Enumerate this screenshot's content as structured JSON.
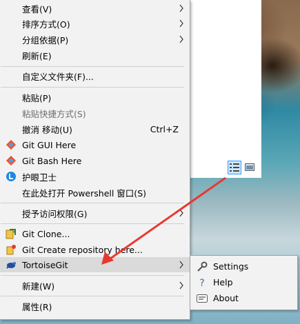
{
  "context_menu": {
    "items": [
      {
        "label": "查看(V)"
      },
      {
        "label": "排序方式(O)"
      },
      {
        "label": "分组依据(P)"
      },
      {
        "label": "刷新(E)"
      },
      {
        "label": "自定义文件夹(F)..."
      },
      {
        "label": "粘贴(P)"
      },
      {
        "label": "粘贴快捷方式(S)"
      },
      {
        "label": "撤消 移动(U)",
        "shortcut": "Ctrl+Z"
      },
      {
        "label": "Git GUI Here"
      },
      {
        "label": "Git Bash Here"
      },
      {
        "label": "护眼卫士"
      },
      {
        "label": "在此处打开 Powershell 窗口(S)"
      },
      {
        "label": "授予访问权限(G)"
      },
      {
        "label": "Git Clone..."
      },
      {
        "label": "Git Create repository here..."
      },
      {
        "label": "TortoiseGit"
      },
      {
        "label": "新建(W)"
      },
      {
        "label": "属性(R)"
      }
    ]
  },
  "tortoisegit_submenu": {
    "items": [
      {
        "label": "Settings"
      },
      {
        "label": "Help"
      },
      {
        "label": "About"
      }
    ]
  },
  "colors": {
    "menu_bg": "#f2f2f2",
    "highlight_bg": "#dadada",
    "annotation_arrow": "#e8392f",
    "git_orange": "#f05133",
    "view_button_accent": "#3399ff"
  }
}
